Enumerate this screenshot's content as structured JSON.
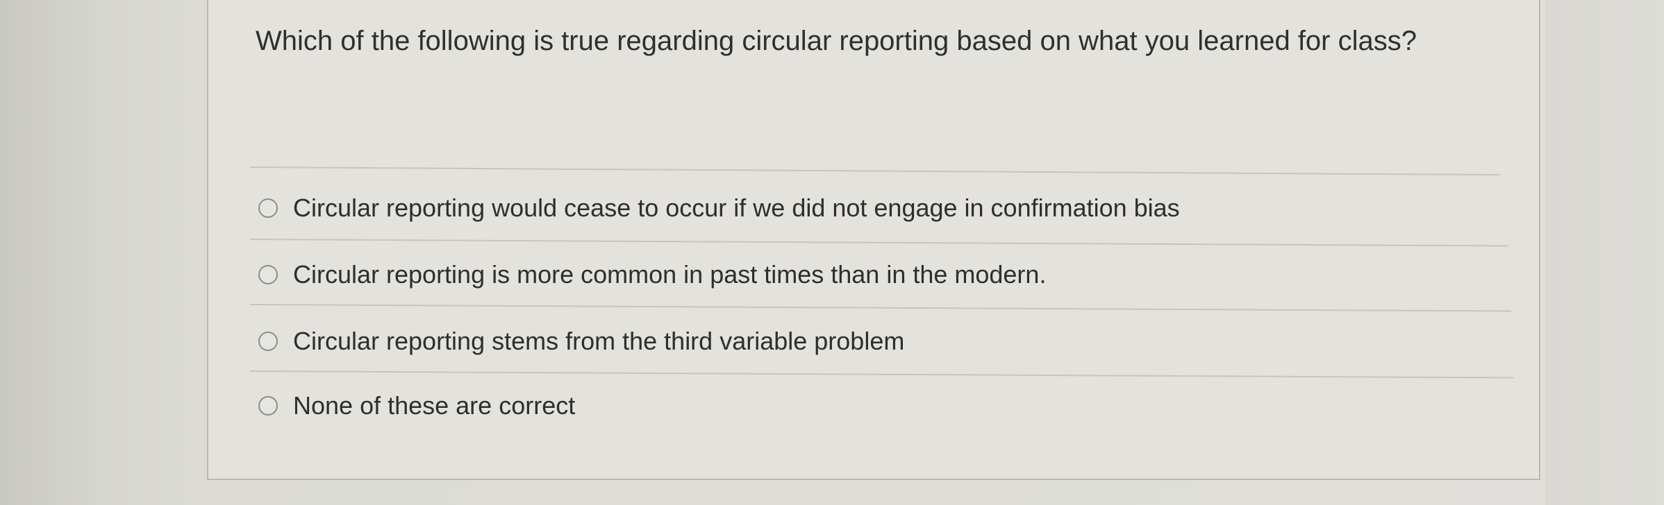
{
  "question": {
    "text": "Which of the following is true regarding circular reporting based on what you learned for class?"
  },
  "options": [
    {
      "label": "Circular reporting would cease to occur if we did not engage in confirmation bias",
      "selected": false
    },
    {
      "label": "Circular reporting is more common in past times than in the modern.",
      "selected": false
    },
    {
      "label": "Circular reporting stems from the third variable problem",
      "selected": false
    },
    {
      "label": "None of these are correct",
      "selected": false
    }
  ]
}
